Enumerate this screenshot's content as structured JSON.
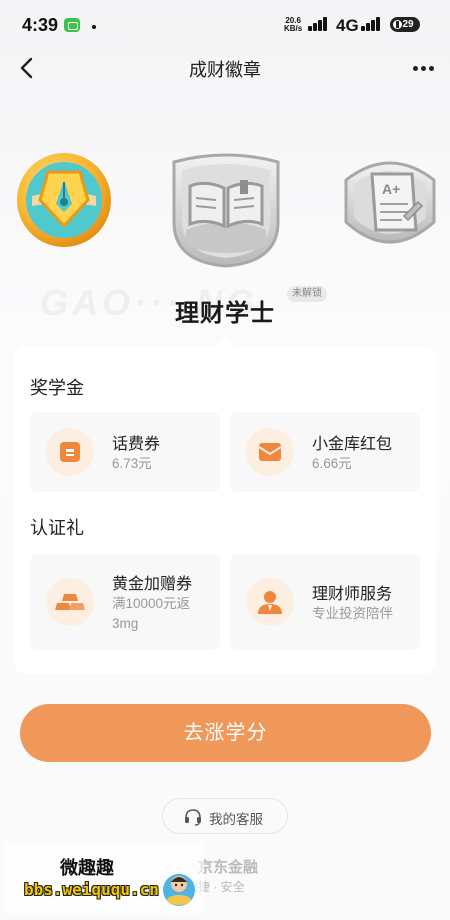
{
  "status_bar": {
    "time": "4:39",
    "net_speed_value": "20.6",
    "net_speed_unit": "KB/s",
    "net_type": "4G",
    "battery": "29"
  },
  "nav": {
    "title": "成财徽章"
  },
  "badge": {
    "title": "理财学士",
    "lock_tag": "未解锁",
    "bg_text": "GAO··· NG"
  },
  "sections": {
    "scholarship": {
      "title": "奖学金",
      "items": [
        {
          "name": "话费券",
          "sub": "6.73元",
          "icon": "wallet-icon"
        },
        {
          "name": "小金库红包",
          "sub": "6.66元",
          "icon": "red-envelope-icon"
        }
      ]
    },
    "certification": {
      "title": "认证礼",
      "items": [
        {
          "name": "黄金加赠券",
          "sub": "满10000元返3mg",
          "icon": "gold-bars-icon"
        },
        {
          "name": "理财师服务",
          "sub": "专业投资陪伴",
          "icon": "advisor-icon"
        }
      ]
    }
  },
  "cta": {
    "label": "去涨学分"
  },
  "service": {
    "label": "我的客服"
  },
  "brand": {
    "name": "京东金融",
    "slogan": "快捷 · 安全"
  },
  "watermark": {
    "title": "微趣趣",
    "url": "bbs.weiququ.cn"
  },
  "colors": {
    "accent": "#f0975a",
    "icon_bg": "#fdeee2",
    "icon_fg": "#f0873f"
  }
}
